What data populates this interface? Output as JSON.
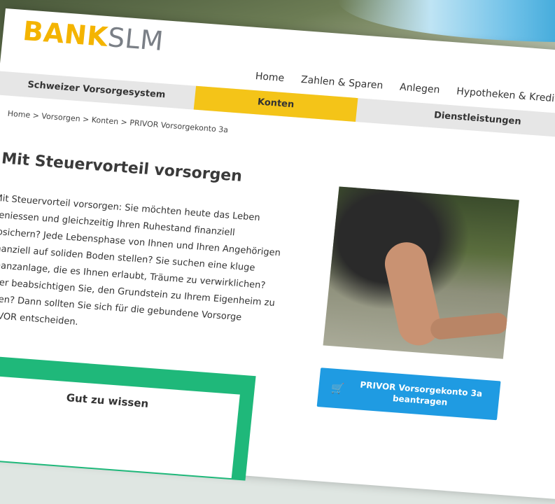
{
  "logo": {
    "bank": "BANK",
    "slm": "SLM"
  },
  "top_nav": [
    "Home",
    "Zahlen & Sparen",
    "Anlegen",
    "Hypotheken & Kredit"
  ],
  "sub_nav": [
    "Schweizer Vorsorgesystem",
    "Konten",
    "Dienstleistungen"
  ],
  "breadcrumb": "Home > Vorsorgen > Konten > PRIVOR Vorsorgekonto 3a",
  "main": {
    "title": "Mit Steuervorteil vorsorgen",
    "intro": "Mit Steuervorteil vorsorgen: Sie möchten heute das Leben geniessen und gleichzeitig Ihren Ruhestand finanziell absichern? Jede Lebensphase von Ihnen und Ihren Angehörigen finanziell auf soliden Boden stellen? Sie suchen eine kluge Finanzanlage, die es Ihnen erlaubt, Träume zu verwirklichen? Oder beabsichtigen Sie, den Grundstein zu Ihrem Eigenheim zu legen? Dann sollten Sie sich für die gebundene Vorsorge PRIVOR entscheiden."
  },
  "info_box": {
    "title": "Gut zu wissen"
  },
  "cta": {
    "label_line1": "PRIVOR Vorsorgekonto 3a",
    "label_line2": "beantragen",
    "icon": "cart-icon"
  },
  "colors": {
    "brand_yellow": "#f4c418",
    "cta_blue": "#1f9be2",
    "info_green": "#1fb87a"
  }
}
